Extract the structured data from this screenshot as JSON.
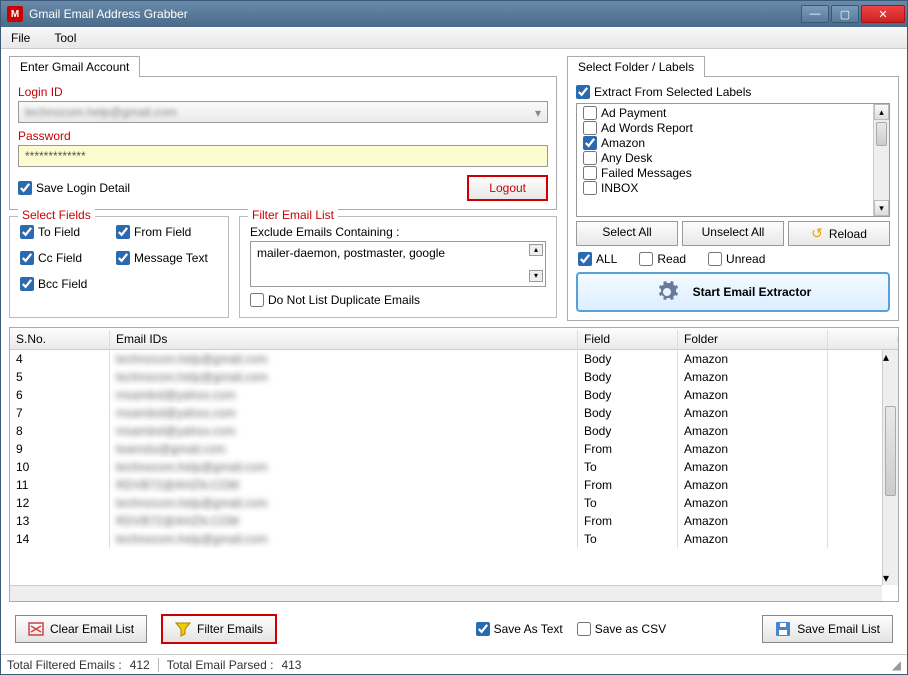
{
  "window": {
    "title": "Gmail Email Address Grabber"
  },
  "menu": {
    "file": "File",
    "tool": "Tool"
  },
  "account": {
    "tab": "Enter Gmail Account",
    "login_label": "Login ID",
    "login_value": "technocom.help@gmail.com",
    "password_label": "Password",
    "password_mask": "*************",
    "save_login": "Save Login Detail",
    "logout": "Logout"
  },
  "fields": {
    "title": "Select Fields",
    "to": "To Field",
    "cc": "Cc Field",
    "bcc": "Bcc Field",
    "from": "From Field",
    "msg": "Message Text"
  },
  "filter": {
    "title": "Filter Email List",
    "exclude_label": "Exclude Emails Containing :",
    "exclude_value": "mailer-daemon, postmaster, google",
    "nodup": "Do Not List Duplicate Emails"
  },
  "folders": {
    "tab": "Select Folder / Labels",
    "extract": "Extract From Selected Labels",
    "items": [
      {
        "label": "Ad Payment",
        "checked": false
      },
      {
        "label": "Ad Words Report",
        "checked": false
      },
      {
        "label": "Amazon",
        "checked": true
      },
      {
        "label": "Any Desk",
        "checked": false
      },
      {
        "label": "Failed Messages",
        "checked": false
      },
      {
        "label": "INBOX",
        "checked": false
      }
    ],
    "select_all": "Select All",
    "unselect_all": "Unselect All",
    "reload": "Reload",
    "all": "ALL",
    "read": "Read",
    "unread": "Unread",
    "start": "Start Email Extractor"
  },
  "table": {
    "headers": {
      "sno": "S.No.",
      "email": "Email IDs",
      "field": "Field",
      "folder": "Folder"
    },
    "rows": [
      {
        "sno": "4",
        "email": "technocom.help@gmail.com",
        "field": "Body",
        "folder": "Amazon"
      },
      {
        "sno": "5",
        "email": "technocom.help@gmail.com",
        "field": "Body",
        "folder": "Amazon"
      },
      {
        "sno": "6",
        "email": "msambol@yahoo.com",
        "field": "Body",
        "folder": "Amazon"
      },
      {
        "sno": "7",
        "email": "msambol@yahoo.com",
        "field": "Body",
        "folder": "Amazon"
      },
      {
        "sno": "8",
        "email": "msambol@yahoo.com",
        "field": "Body",
        "folder": "Amazon"
      },
      {
        "sno": "9",
        "email": "teamstu@gmail.com",
        "field": "From",
        "folder": "Amazon"
      },
      {
        "sno": "10",
        "email": "technocom.help@gmail.com",
        "field": "To",
        "folder": "Amazon"
      },
      {
        "sno": "11",
        "email": "RDVB72@AHZN.COM",
        "field": "From",
        "folder": "Amazon"
      },
      {
        "sno": "12",
        "email": "technocom.help@gmail.com",
        "field": "To",
        "folder": "Amazon"
      },
      {
        "sno": "13",
        "email": "RDVB72@AHZN.COM",
        "field": "From",
        "folder": "Amazon"
      },
      {
        "sno": "14",
        "email": "technocom.help@gmail.com",
        "field": "To",
        "folder": "Amazon"
      }
    ]
  },
  "bottom": {
    "clear": "Clear Email List",
    "filter": "Filter Emails",
    "save_text": "Save As Text",
    "save_csv": "Save as CSV",
    "save_list": "Save Email List"
  },
  "status": {
    "filtered_label": "Total Filtered Emails :",
    "filtered_value": "412",
    "parsed_label": "Total Email Parsed :",
    "parsed_value": "413"
  }
}
